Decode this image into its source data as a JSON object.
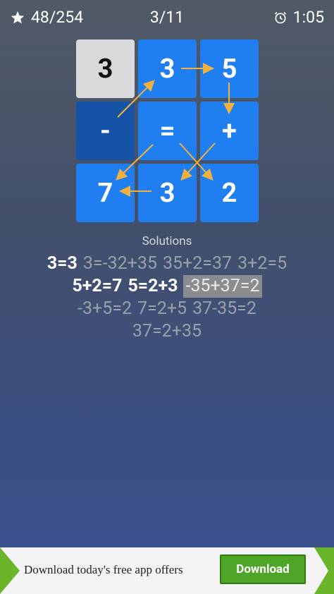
{
  "header": {
    "stars_label": "48/254",
    "level_label": "3/11",
    "timer_label": "1:05"
  },
  "grid": {
    "tiles": [
      {
        "label": "3",
        "style": "gray"
      },
      {
        "label": "3",
        "style": "blue"
      },
      {
        "label": "5",
        "style": "blue"
      },
      {
        "label": "-",
        "style": "dark"
      },
      {
        "label": "=",
        "style": "blue"
      },
      {
        "label": "+",
        "style": "blue"
      },
      {
        "label": "7",
        "style": "blue"
      },
      {
        "label": "3",
        "style": "blue"
      },
      {
        "label": "2",
        "style": "blue"
      }
    ],
    "arrow_color": "#f3b13a"
  },
  "solutions": {
    "title": "Solutions",
    "items": [
      {
        "text": "3=3",
        "state": "found"
      },
      {
        "text": "3=-32+35",
        "state": "hidden"
      },
      {
        "text": "35+2=37",
        "state": "hidden"
      },
      {
        "text": "3+2=5",
        "state": "hidden"
      },
      {
        "text": "5+2=7",
        "state": "found"
      },
      {
        "text": "5=2+3",
        "state": "found"
      },
      {
        "text": "-35+37=2",
        "state": "selected"
      },
      {
        "text": "-3+5=2",
        "state": "hidden"
      },
      {
        "text": "7=2+5",
        "state": "hidden"
      },
      {
        "text": "37-35=2",
        "state": "hidden"
      },
      {
        "text": "37=2+35",
        "state": "hidden"
      }
    ]
  },
  "ad": {
    "text": "Download today's free app offers",
    "button_label": "Download",
    "accent_color": "#4fa527"
  }
}
